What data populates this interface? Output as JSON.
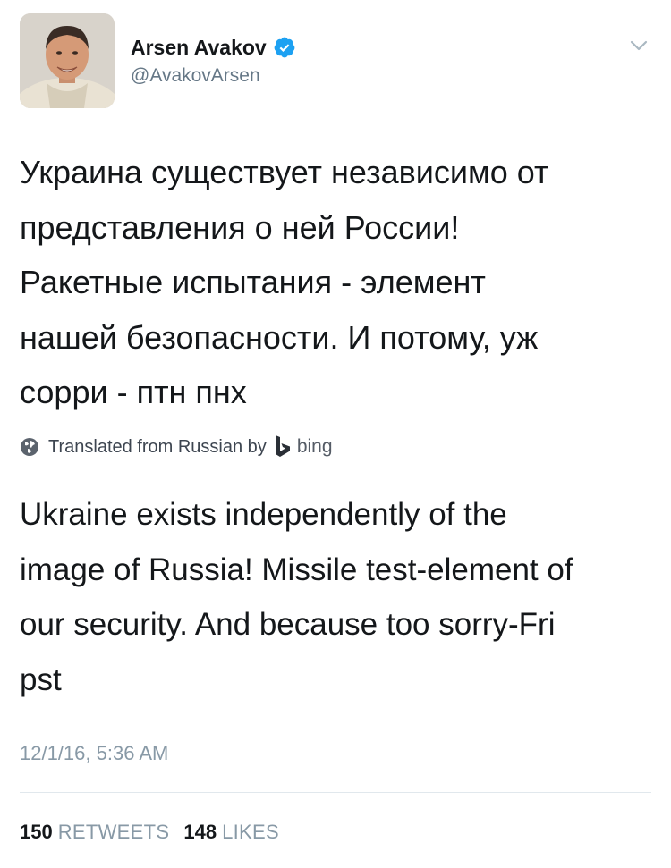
{
  "user": {
    "display_name": "Arsen Avakov",
    "handle": "@AvakovArsen",
    "verified": true,
    "verified_color": "#1da1f2"
  },
  "tweet": {
    "text": "Украина существует независимо от\nпредставления о ней России!\nРакетные испытания - элемент\nнашей безопасности. И потому, уж\nсорри - птн пнх",
    "translation_label": "Translated from Russian by",
    "translation_provider": "bing",
    "translation": "Ukraine exists independently of the\nimage of Russia! Missile test-element of\nour security. And because too sorry-Fri\npst",
    "timestamp": "12/1/16, 5:36 AM"
  },
  "stats": {
    "retweets_count": "150",
    "retweets_label": "RETWEETS",
    "likes_count": "148",
    "likes_label": "LIKES"
  },
  "icons": {
    "verified": "verified-badge-icon",
    "menu": "chevron-down-icon",
    "globe": "globe-icon",
    "bing": "bing-logo-icon"
  }
}
